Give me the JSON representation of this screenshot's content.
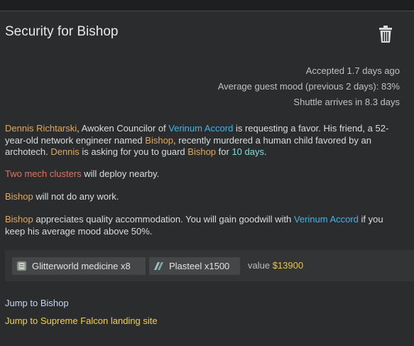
{
  "quest": {
    "title": "Security for Bishop",
    "accepted": "Accepted 1.7 days ago",
    "mood": "Average guest mood (previous 2 days): 83%",
    "shuttle": "Shuttle arrives in 8.3 days"
  },
  "description": {
    "p1": {
      "requester": "Dennis Richtarski",
      "t1": ", Awoken Councilor of ",
      "faction": "Verinum Accord",
      "t2": " is requesting a favor. His friend, a 52-year-old network engineer named ",
      "guest": "Bishop",
      "t3": ", recently murdered a human child favored by an archotech. ",
      "requester_short": "Dennis",
      "t4": " is asking for you to guard ",
      "guest2": "Bishop",
      "t5": " for ",
      "duration": "10 days",
      "t6": "."
    },
    "p2": {
      "threat": "Two mech clusters",
      "rest": " will deploy nearby."
    },
    "p3": {
      "guest": "Bishop",
      "rest": " will not do any work."
    },
    "p4": {
      "guest": "Bishop",
      "t1": " appreciates quality accommodation. You will gain goodwill with ",
      "faction": "Verinum Accord",
      "t2": " if you keep his average mood above 50%."
    }
  },
  "rewards": {
    "items": [
      {
        "label": "Glitterworld medicine x8",
        "icon": "glitterworld-medicine-icon"
      },
      {
        "label": "Plasteel x1500",
        "icon": "plasteel-icon"
      }
    ],
    "value_label": "value",
    "value_amount": "$13900"
  },
  "links": {
    "jump_guest": "Jump to Bishop",
    "jump_site": "Jump to Supreme Falcon landing site"
  },
  "colors": {
    "accent_orange": "#e0a85e",
    "faction_blue": "#3eb6ea",
    "threat_red": "#e0735d",
    "duration_cyan": "#7fdcdc",
    "value_gold": "#f2c33a",
    "link_yellow": "#f2d43a"
  },
  "icons": {
    "delete": "trash-icon"
  }
}
